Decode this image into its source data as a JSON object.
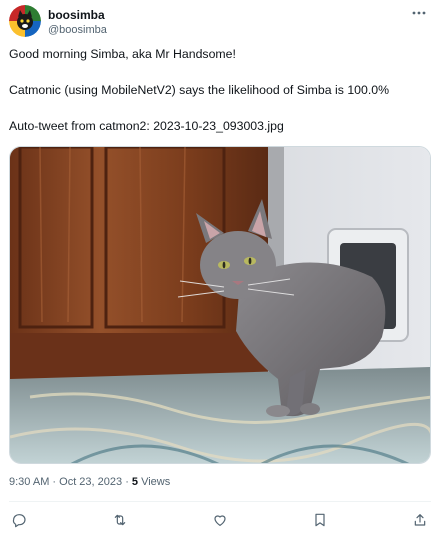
{
  "user": {
    "display_name": "boosimba",
    "handle": "@boosimba",
    "more_icon": "more-horizontal-icon"
  },
  "tweet": {
    "line1": "Good morning Simba, aka Mr Handsome!",
    "line2": "Catmonic (using MobileNetV2) says the likelihood of Simba is 100.0%",
    "line3": "Auto-tweet from catmon2: 2023-10-23_093003.jpg"
  },
  "meta": {
    "time": "9:30 AM",
    "separator1": " · ",
    "date": "Oct 23, 2023",
    "separator2": " · ",
    "views_count": "5",
    "views_label": " Views"
  },
  "actions": {
    "reply_icon": "reply-icon",
    "retweet_icon": "retweet-icon",
    "like_icon": "heart-icon",
    "bookmark_icon": "bookmark-icon",
    "share_icon": "share-icon"
  },
  "colors": {
    "text": "#0f1419",
    "secondary": "#536471",
    "border": "#cfd9de",
    "divider": "#eff3f4"
  }
}
